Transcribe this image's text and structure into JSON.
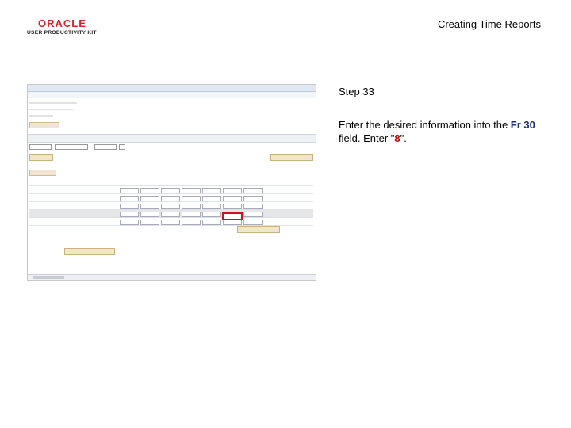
{
  "header": {
    "brand": "ORACLE",
    "product": "USER PRODUCTIVITY KIT",
    "doc_title": "Creating Time Reports"
  },
  "step": {
    "title": "Step 33",
    "instruction_prefix": "Enter the desired information into the ",
    "field_name": "Fr 30",
    "instruction_middle": " field. Enter \"",
    "entry_value": "8",
    "instruction_suffix": "\"."
  },
  "colors": {
    "brand_red": "#d2232a",
    "field_blue": "#1f2f80",
    "value_red": "#c00000",
    "focus_border": "#d0101a"
  },
  "screenshot": {
    "focused_cell": "fr-30-cell"
  }
}
